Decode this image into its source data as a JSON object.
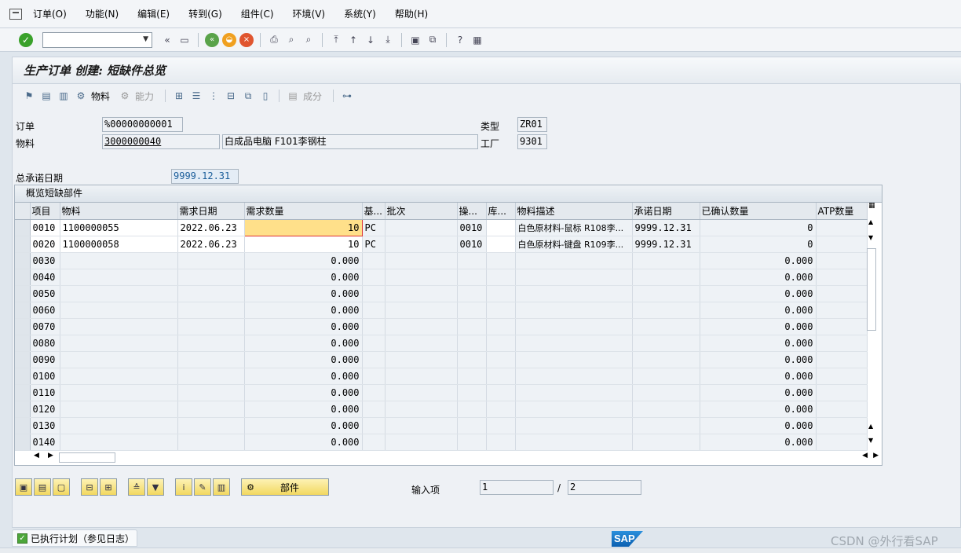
{
  "menu": [
    "订单(O)",
    "功能(N)",
    "编辑(E)",
    "转到(G)",
    "组件(C)",
    "环境(V)",
    "系统(Y)",
    "帮助(H)"
  ],
  "screen_title": "生产订单 创建: 短缺件总览",
  "app_toolbar": {
    "material_label": "物料",
    "capacity_label": "能力",
    "component_label": "成分"
  },
  "header": {
    "order_label": "订单",
    "order_value": "%00000000001",
    "type_label": "类型",
    "type_value": "ZR01",
    "material_label": "物料",
    "material_value": "3000000040",
    "material_desc": "白成品电脑 F101李钢柱",
    "plant_label": "工厂",
    "plant_value": "9301",
    "commit_date_label": "总承诺日期",
    "commit_date_value": "9999.12.31"
  },
  "table": {
    "title": "概览短缺部件",
    "columns": [
      "项目",
      "物料",
      "需求日期",
      "需求数量",
      "基...",
      "批次",
      "操...",
      "库...",
      "物料描述",
      "承诺日期",
      "已确认数量",
      "ATP数量"
    ],
    "rows": [
      {
        "item": "0010",
        "material": "1100000055",
        "req_date": "2022.06.23",
        "req_qty": "10",
        "unit": "PC",
        "batch": "",
        "op": "0010",
        "sloc": "",
        "desc": "白色原材料-鼠标 R108李...",
        "commit_date": "9999.12.31",
        "conf_qty": "0",
        "atp": ""
      },
      {
        "item": "0020",
        "material": "1100000058",
        "req_date": "2022.06.23",
        "req_qty": "10",
        "unit": "PC",
        "batch": "",
        "op": "0010",
        "sloc": "",
        "desc": "白色原材料-键盘 R109李...",
        "commit_date": "9999.12.31",
        "conf_qty": "0",
        "atp": ""
      },
      {
        "item": "0030",
        "req_qty": "0.000",
        "conf_qty": "0.000"
      },
      {
        "item": "0040",
        "req_qty": "0.000",
        "conf_qty": "0.000"
      },
      {
        "item": "0050",
        "req_qty": "0.000",
        "conf_qty": "0.000"
      },
      {
        "item": "0060",
        "req_qty": "0.000",
        "conf_qty": "0.000"
      },
      {
        "item": "0070",
        "req_qty": "0.000",
        "conf_qty": "0.000"
      },
      {
        "item": "0080",
        "req_qty": "0.000",
        "conf_qty": "0.000"
      },
      {
        "item": "0090",
        "req_qty": "0.000",
        "conf_qty": "0.000"
      },
      {
        "item": "0100",
        "req_qty": "0.000",
        "conf_qty": "0.000"
      },
      {
        "item": "0110",
        "req_qty": "0.000",
        "conf_qty": "0.000"
      },
      {
        "item": "0120",
        "req_qty": "0.000",
        "conf_qty": "0.000"
      },
      {
        "item": "0130",
        "req_qty": "0.000",
        "conf_qty": "0.000"
      },
      {
        "item": "0140",
        "req_qty": "0.000",
        "conf_qty": "0.000"
      }
    ]
  },
  "components_button_label": "部件",
  "entry": {
    "label": "输入项",
    "current": "1",
    "separator": "/",
    "total": "2"
  },
  "status": {
    "text": "已执行计划（参见日志）"
  },
  "sap_logo": "SAP",
  "watermark": "CSDN @外行看SAP",
  "colors": {
    "highlight_cell": "#ffe08a",
    "accent": "#1b5e9a",
    "sap_blue": "#0a5fb0"
  }
}
